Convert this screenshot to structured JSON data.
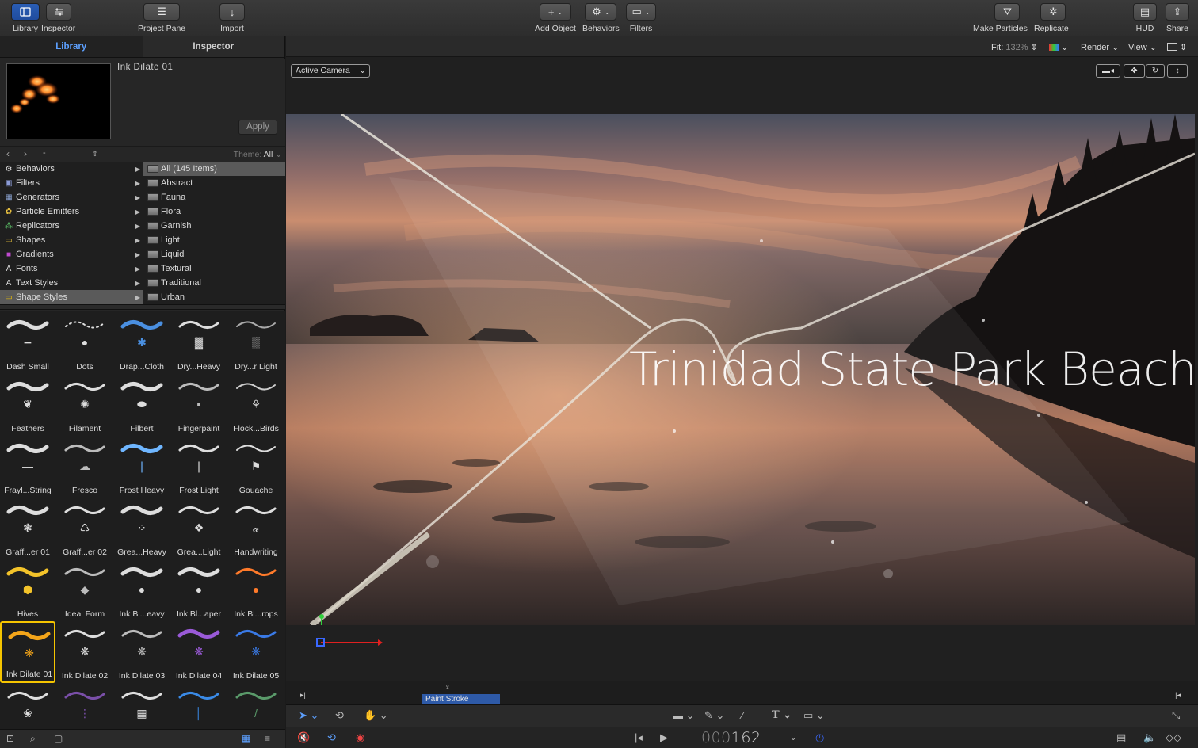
{
  "toolbar": {
    "library_label": "Library",
    "inspector_label": "Inspector",
    "project_pane_label": "Project Pane",
    "import_label": "Import",
    "add_object_label": "Add Object",
    "behaviors_label": "Behaviors",
    "filters_label": "Filters",
    "make_particles_label": "Make Particles",
    "replicate_label": "Replicate",
    "hud_label": "HUD",
    "share_label": "Share"
  },
  "left_tabs": {
    "library": "Library",
    "inspector": "Inspector"
  },
  "preview": {
    "title": "Ink Dilate 01",
    "apply_label": "Apply"
  },
  "nav": {
    "path": "-",
    "theme_label": "Theme:",
    "theme_value": "All"
  },
  "categories": [
    {
      "label": "Behaviors",
      "icon": "gear-icon"
    },
    {
      "label": "Filters",
      "icon": "filter-icon"
    },
    {
      "label": "Generators",
      "icon": "generator-icon"
    },
    {
      "label": "Particle Emitters",
      "icon": "emitter-icon"
    },
    {
      "label": "Replicators",
      "icon": "replicator-icon"
    },
    {
      "label": "Shapes",
      "icon": "shape-icon"
    },
    {
      "label": "Gradients",
      "icon": "gradient-icon"
    },
    {
      "label": "Fonts",
      "icon": "font-icon"
    },
    {
      "label": "Text Styles",
      "icon": "text-style-icon"
    },
    {
      "label": "Shape Styles",
      "icon": "shape-style-icon"
    }
  ],
  "selected_category": "Shape Styles",
  "themes": [
    "All (145 Items)",
    "Abstract",
    "Fauna",
    "Flora",
    "Garnish",
    "Light",
    "Liquid",
    "Textural",
    "Traditional",
    "Urban"
  ],
  "selected_theme": "All (145 Items)",
  "grid_items": [
    "Dash Small",
    "Dots",
    "Drap...Cloth",
    "Dry...Heavy",
    "Dry...r Light",
    "Feathers",
    "Filament",
    "Filbert",
    "Fingerpaint",
    "Flock...Birds",
    "Frayl...String",
    "Fresco",
    "Frost Heavy",
    "Frost Light",
    "Gouache",
    "Graff...er 01",
    "Graff...er 02",
    "Grea...Heavy",
    "Grea...Light",
    "Handwriting",
    "Hives",
    "Ideal Form",
    "Ink Bl...eavy",
    "Ink Bl...aper",
    "Ink Bl...rops",
    "Ink Dilate 01",
    "Ink Dilate 02",
    "Ink Dilate 03",
    "Ink Dilate 04",
    "Ink Dilate 05",
    "",
    "",
    "",
    "",
    ""
  ],
  "selected_item": "Ink Dilate 01",
  "viewer": {
    "fit_label": "Fit:",
    "fit_value": "132%",
    "render_label": "Render",
    "view_label": "View",
    "camera_label": "Active Camera",
    "canvas_title": "Trinidad State Park Beach"
  },
  "timeline": {
    "clip_label": "Paint Stroke"
  },
  "transport": {
    "timecode_dim": "000",
    "timecode_bright": "162"
  },
  "colors": {
    "accent_blue": "#5da0ff",
    "selection_yellow": "#f5c400",
    "clip_blue": "#2e5aa8"
  }
}
